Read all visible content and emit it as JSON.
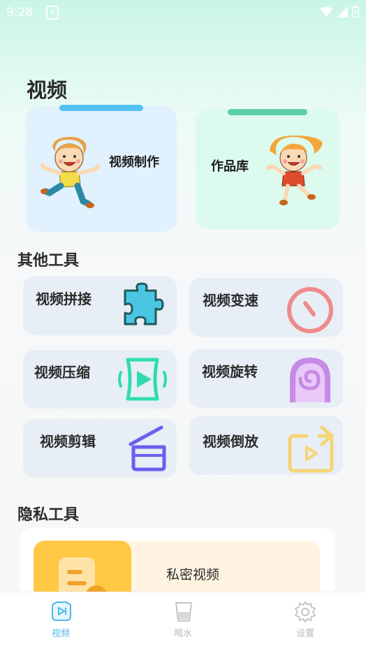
{
  "status_bar": {
    "time": "9:28"
  },
  "page_title": "视频",
  "cards": {
    "make": {
      "label": "视频制作"
    },
    "library": {
      "label": "作品库"
    }
  },
  "sections": {
    "other_tools": "其他工具",
    "privacy_tools": "隐私工具"
  },
  "tools": [
    {
      "label": "视频拼接",
      "icon": "puzzle-icon"
    },
    {
      "label": "视频变速",
      "icon": "speed-dial-icon"
    },
    {
      "label": "视频压缩",
      "icon": "compress-icon"
    },
    {
      "label": "视频旋转",
      "icon": "rotate-spiral-icon"
    },
    {
      "label": "视频剪辑",
      "icon": "clapperboard-icon"
    },
    {
      "label": "视频倒放",
      "icon": "reverse-play-icon"
    }
  ],
  "privacy": {
    "label": "私密视频"
  },
  "tabbar": {
    "items": [
      {
        "label": "视频",
        "active": true
      },
      {
        "label": "喝水",
        "active": false
      },
      {
        "label": "设置",
        "active": false
      }
    ],
    "active_color": "#4fb8e8",
    "inactive_color": "#b9b9b9"
  }
}
